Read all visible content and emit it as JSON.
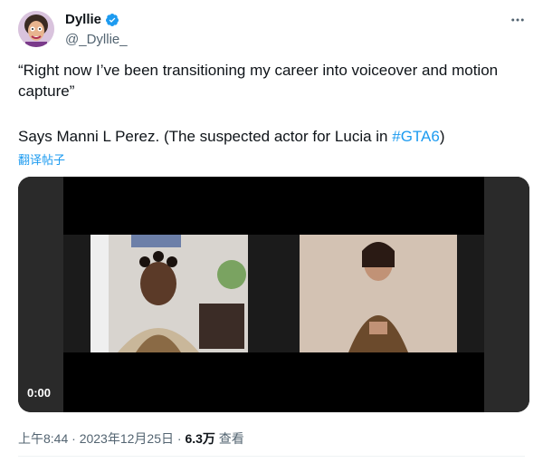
{
  "author": {
    "name": "Dyllie",
    "handle": "@_Dyllie_",
    "verified": true
  },
  "tweet": {
    "text_line1": "“Right now I’ve been transitioning my career into voiceover and motion capture”",
    "text_line2_prefix": "Says Manni L Perez. (The suspected actor for Lucia in ",
    "hashtag": "#GTA6",
    "text_line2_suffix": ")",
    "translate_label": "翻译帖子"
  },
  "video": {
    "time": "0:00"
  },
  "meta": {
    "time": "上午8:44",
    "separator1": " · ",
    "date": "2023年12月25日",
    "separator2": " · ",
    "views_count": "6.3万",
    "views_label": " 查看"
  },
  "colors": {
    "accent": "#1d9bf0",
    "text": "#0f1419",
    "secondary": "#536471"
  },
  "icons": {
    "verified": "verified-badge-icon",
    "more": "more-icon"
  }
}
